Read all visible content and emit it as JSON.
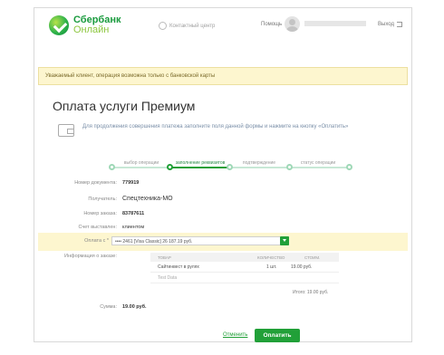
{
  "header": {
    "logo_line1": "Сбербанк",
    "logo_line2": "Онлайн",
    "contact_center": "Контактный центр",
    "help": "Помощь",
    "logout": "Выход"
  },
  "warning_text": "Уважаемый клиент, операция возможна только с банковской карты",
  "title": "Оплата услуги Премиум",
  "hint": "Для продолжения совершения платежа заполните поля данной формы и нажмите на кнопку «Оплатить»",
  "steps": [
    {
      "label": "выбор операции"
    },
    {
      "label": "заполнение реквизитов"
    },
    {
      "label": "подтверждение"
    },
    {
      "label": "статус операции"
    }
  ],
  "fields": {
    "doc_number_label": "Номер документа:",
    "doc_number": "779919",
    "recipient_label": "Получатель:",
    "recipient": "Спецтехника-МО",
    "order_label": "Номер заказа:",
    "order": "83787611",
    "invoice_label": "Счет выставлен:",
    "invoice": "клиентом",
    "payfrom_label": "Оплата с *",
    "payfrom_value": "•••• 2461 [Visa Classic] 26 187.19 руб.",
    "orderinfo_label": "Информация о заказе:",
    "sum_label": "Сумма:",
    "sum_value": "19.00 руб."
  },
  "table": {
    "headers": [
      "ТОВАР",
      "КОЛИЧЕСТВО",
      "СТОИМ."
    ],
    "rows": [
      {
        "name": "Сайтинвест в рулях",
        "qty": "1 шт.",
        "price": "19.00 руб."
      },
      {
        "name": "Test Data",
        "qty": "",
        "price": ""
      }
    ],
    "total": "Итого: 19.00 руб."
  },
  "buttons": {
    "cancel": "Отменить",
    "pay": "Оплатить"
  },
  "colors": {
    "brand_green": "#21a038",
    "warning_bg": "#fdf6cf"
  },
  "icons": [
    "sberbank-logo-icon",
    "phone-icon",
    "avatar-icon",
    "logout-icon",
    "wallet-icon",
    "chevron-down-icon"
  ]
}
